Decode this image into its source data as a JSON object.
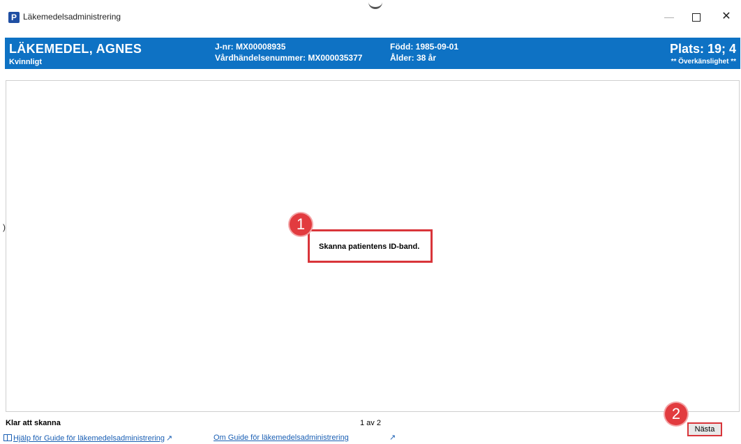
{
  "window": {
    "title": "Läkemedelsadministrering",
    "app_icon_letter": "P",
    "minimize_glyph": "—",
    "close_glyph": "✕"
  },
  "patient": {
    "name": "LÄKEMEDEL, AGNES",
    "gender": "Kvinnligt",
    "journal_number": "J-nr: MX00008935",
    "care_event_number": "Vårdhändelsenummer: MX000035377",
    "born": "Född: 1985-09-01",
    "age": "Ålder: 38 år",
    "place": "Plats: 19; 4",
    "allergy_flag": "** Överkänslighet **"
  },
  "main": {
    "instruction": "Skanna patientens ID-band.",
    "callout_1": "1",
    "callout_2": "2",
    "left_glyph": ")"
  },
  "footer": {
    "status": "Klar att skanna",
    "page_indicator": "1 av 2",
    "next_button": "Nästa",
    "help_link": "Hjälp för Guide för läkemedelsadministrering",
    "about_link": "Om Guide för läkemedelsadministrering",
    "external_glyph": "↗"
  },
  "colors": {
    "banner": "#0e72c4",
    "callout": "#e23b3f",
    "highlight_border": "#d9353a",
    "link": "#1a5fb4"
  }
}
